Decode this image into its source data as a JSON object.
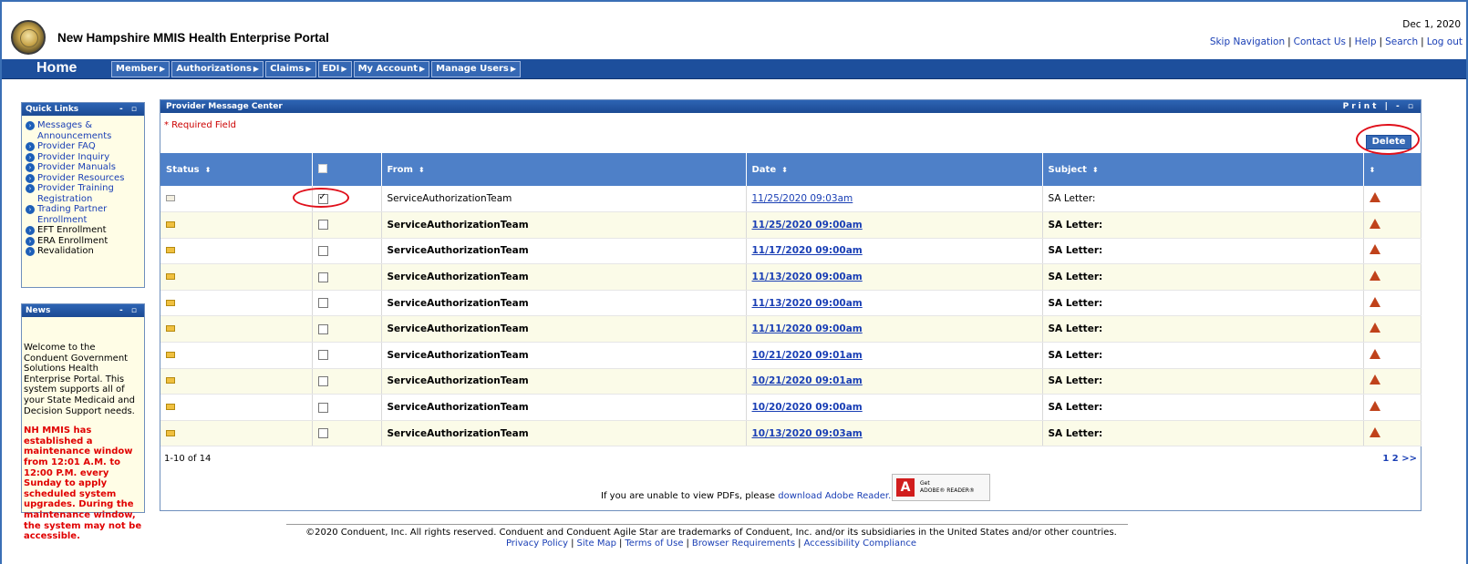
{
  "header": {
    "title": "New Hampshire MMIS Health Enterprise Portal",
    "date": "Dec 1, 2020",
    "links": [
      "Skip Navigation",
      "Contact Us",
      "Help",
      "Search",
      "Log out"
    ]
  },
  "nav": {
    "home": "Home",
    "items": [
      "Member",
      "Authorizations",
      "Claims",
      "EDI",
      "My Account",
      "Manage Users"
    ]
  },
  "quick_links": {
    "title": "Quick Links",
    "items": [
      "Messages & Announcements",
      "Provider FAQ",
      "Provider Inquiry",
      "Provider Manuals",
      "Provider Resources",
      "Provider Training Registration",
      "Trading Partner Enrollment",
      "EFT Enrollment",
      "ERA Enrollment",
      "Revalidation"
    ]
  },
  "news": {
    "title": "News",
    "welcome": "Welcome to the Conduent Government Solutions Health Enterprise Portal. This system supports all of your State Medicaid and Decision Support needs.",
    "maintenance": "NH MMIS has established a maintenance window from 12:01 A.M. to 12:00 P.M. every Sunday to apply scheduled system upgrades. During the maintenance window, the system may not be accessible."
  },
  "message_center": {
    "title": "Provider Message Center",
    "print": "Print |",
    "required": "* Required Field",
    "delete_label": "Delete",
    "columns": [
      "Status",
      "From",
      "Date",
      "Subject"
    ],
    "rows": [
      {
        "from": "ServiceAuthorizationTeam",
        "date": "11/25/2020 09:03am",
        "subject": "SA Letter:",
        "checked": true,
        "read": true
      },
      {
        "from": "ServiceAuthorizationTeam",
        "date": "11/25/2020 09:00am",
        "subject": "SA Letter:",
        "checked": false,
        "read": false
      },
      {
        "from": "ServiceAuthorizationTeam",
        "date": "11/17/2020 09:00am",
        "subject": "SA Letter:",
        "checked": false,
        "read": false
      },
      {
        "from": "ServiceAuthorizationTeam",
        "date": "11/13/2020 09:00am",
        "subject": "SA Letter:",
        "checked": false,
        "read": false
      },
      {
        "from": "ServiceAuthorizationTeam",
        "date": "11/13/2020 09:00am",
        "subject": "SA Letter:",
        "checked": false,
        "read": false
      },
      {
        "from": "ServiceAuthorizationTeam",
        "date": "11/11/2020 09:00am",
        "subject": "SA Letter:",
        "checked": false,
        "read": false
      },
      {
        "from": "ServiceAuthorizationTeam",
        "date": "10/21/2020 09:01am",
        "subject": "SA Letter:",
        "checked": false,
        "read": false
      },
      {
        "from": "ServiceAuthorizationTeam",
        "date": "10/21/2020 09:01am",
        "subject": "SA Letter:",
        "checked": false,
        "read": false
      },
      {
        "from": "ServiceAuthorizationTeam",
        "date": "10/20/2020 09:00am",
        "subject": "SA Letter:",
        "checked": false,
        "read": false
      },
      {
        "from": "ServiceAuthorizationTeam",
        "date": "10/13/2020 09:03am",
        "subject": "SA Letter:",
        "checked": false,
        "read": false
      }
    ],
    "range": "1-10 of 14",
    "pages": "1 2 >>",
    "pdf_note": "If you are unable to view PDFs, please",
    "pdf_link": "download Adobe Reader.",
    "adobe_get": "Get",
    "adobe_reader": "ADOBE® READER®"
  },
  "footer": {
    "copyright": "©2020 Conduent, Inc. All rights reserved. Conduent and Conduent Agile Star are trademarks of Conduent, Inc. and/or its subsidiaries in the United States and/or other countries.",
    "links": [
      "Privacy Policy",
      "Site Map",
      "Terms of Use",
      "Browser Requirements",
      "Accessibility Compliance"
    ]
  }
}
